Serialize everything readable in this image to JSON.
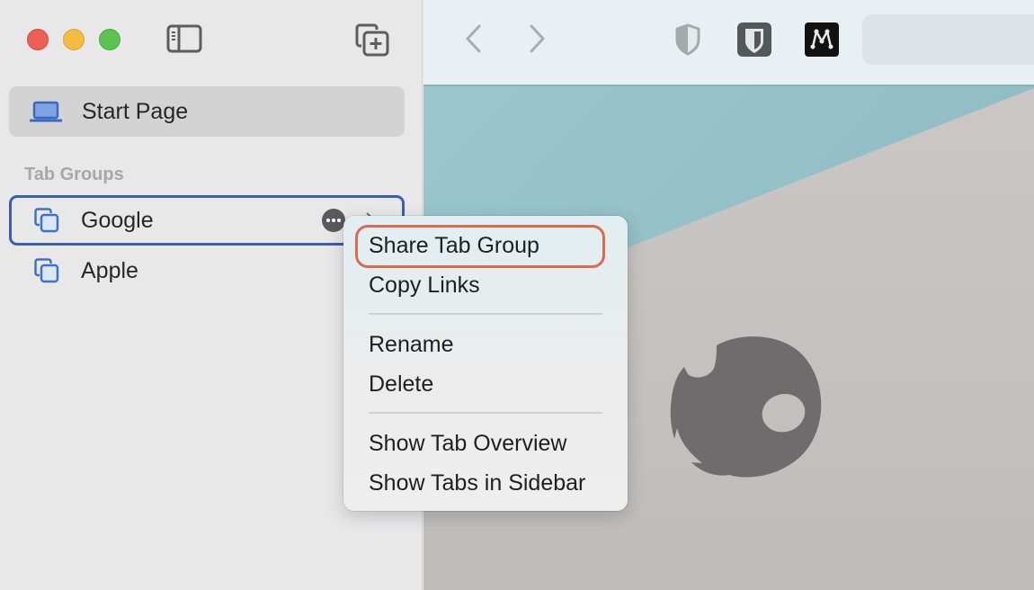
{
  "window": {
    "controls": [
      "close",
      "minimize",
      "zoom"
    ],
    "colors": {
      "close": "#ec5f57",
      "minimize": "#f4bc42",
      "zoom": "#5cc353"
    }
  },
  "sidebar": {
    "toggle_icon": "sidebar-icon",
    "new_tab_group_icon": "new-tab-group-icon",
    "start_page": {
      "label": "Start Page",
      "icon": "laptop-icon"
    },
    "section_title": "Tab Groups",
    "tab_groups": [
      {
        "label": "Google",
        "icon": "tab-group-icon",
        "selected": true
      },
      {
        "label": "Apple",
        "icon": "tab-group-icon",
        "selected": false
      }
    ],
    "selection_color": "#3a5eb0"
  },
  "toolbar": {
    "back_icon": "chevron-left-icon",
    "forward_icon": "chevron-right-icon",
    "extensions": [
      {
        "name": "privacy-shield",
        "icon": "shield-icon"
      },
      {
        "name": "bitwarden",
        "icon": "bitwarden-shield-icon"
      },
      {
        "name": "m-extension",
        "icon": "m-logo-icon"
      }
    ],
    "address_bar": {
      "value": ""
    }
  },
  "context_menu": {
    "items": [
      {
        "label": "Share Tab Group",
        "highlighted": true
      },
      {
        "label": "Copy Links"
      },
      {
        "separator": true
      },
      {
        "label": "Rename"
      },
      {
        "label": "Delete"
      },
      {
        "separator": true
      },
      {
        "label": "Show Tab Overview"
      },
      {
        "label": "Show Tabs in Sidebar"
      }
    ],
    "labels": {
      "share": "Share Tab Group",
      "copy": "Copy Links",
      "rename": "Rename",
      "delete": "Delete",
      "overview": "Show Tab Overview",
      "sidebar": "Show Tabs in Sidebar"
    },
    "highlight_color": "#dc6a4f"
  },
  "content": {
    "wallpaper": {
      "sky_color": "#9cc6cd",
      "ground_color": "#c6c3c0"
    },
    "logo_icon": "start-page-logo-icon",
    "logo_color": "#6e6c6c"
  }
}
